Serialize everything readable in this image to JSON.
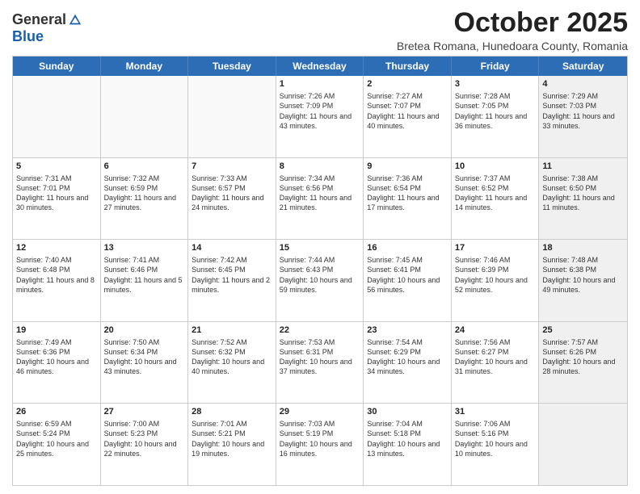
{
  "logo": {
    "general": "General",
    "blue": "Blue"
  },
  "title": "October 2025",
  "subtitle": "Bretea Romana, Hunedoara County, Romania",
  "headers": [
    "Sunday",
    "Monday",
    "Tuesday",
    "Wednesday",
    "Thursday",
    "Friday",
    "Saturday"
  ],
  "rows": [
    [
      {
        "day": "",
        "text": "",
        "empty": true
      },
      {
        "day": "",
        "text": "",
        "empty": true
      },
      {
        "day": "",
        "text": "",
        "empty": true
      },
      {
        "day": "1",
        "text": "Sunrise: 7:26 AM\nSunset: 7:09 PM\nDaylight: 11 hours and 43 minutes.",
        "empty": false
      },
      {
        "day": "2",
        "text": "Sunrise: 7:27 AM\nSunset: 7:07 PM\nDaylight: 11 hours and 40 minutes.",
        "empty": false
      },
      {
        "day": "3",
        "text": "Sunrise: 7:28 AM\nSunset: 7:05 PM\nDaylight: 11 hours and 36 minutes.",
        "empty": false
      },
      {
        "day": "4",
        "text": "Sunrise: 7:29 AM\nSunset: 7:03 PM\nDaylight: 11 hours and 33 minutes.",
        "empty": false,
        "shaded": true
      }
    ],
    [
      {
        "day": "5",
        "text": "Sunrise: 7:31 AM\nSunset: 7:01 PM\nDaylight: 11 hours and 30 minutes.",
        "empty": false
      },
      {
        "day": "6",
        "text": "Sunrise: 7:32 AM\nSunset: 6:59 PM\nDaylight: 11 hours and 27 minutes.",
        "empty": false
      },
      {
        "day": "7",
        "text": "Sunrise: 7:33 AM\nSunset: 6:57 PM\nDaylight: 11 hours and 24 minutes.",
        "empty": false
      },
      {
        "day": "8",
        "text": "Sunrise: 7:34 AM\nSunset: 6:56 PM\nDaylight: 11 hours and 21 minutes.",
        "empty": false
      },
      {
        "day": "9",
        "text": "Sunrise: 7:36 AM\nSunset: 6:54 PM\nDaylight: 11 hours and 17 minutes.",
        "empty": false
      },
      {
        "day": "10",
        "text": "Sunrise: 7:37 AM\nSunset: 6:52 PM\nDaylight: 11 hours and 14 minutes.",
        "empty": false
      },
      {
        "day": "11",
        "text": "Sunrise: 7:38 AM\nSunset: 6:50 PM\nDaylight: 11 hours and 11 minutes.",
        "empty": false,
        "shaded": true
      }
    ],
    [
      {
        "day": "12",
        "text": "Sunrise: 7:40 AM\nSunset: 6:48 PM\nDaylight: 11 hours and 8 minutes.",
        "empty": false
      },
      {
        "day": "13",
        "text": "Sunrise: 7:41 AM\nSunset: 6:46 PM\nDaylight: 11 hours and 5 minutes.",
        "empty": false
      },
      {
        "day": "14",
        "text": "Sunrise: 7:42 AM\nSunset: 6:45 PM\nDaylight: 11 hours and 2 minutes.",
        "empty": false
      },
      {
        "day": "15",
        "text": "Sunrise: 7:44 AM\nSunset: 6:43 PM\nDaylight: 10 hours and 59 minutes.",
        "empty": false
      },
      {
        "day": "16",
        "text": "Sunrise: 7:45 AM\nSunset: 6:41 PM\nDaylight: 10 hours and 56 minutes.",
        "empty": false
      },
      {
        "day": "17",
        "text": "Sunrise: 7:46 AM\nSunset: 6:39 PM\nDaylight: 10 hours and 52 minutes.",
        "empty": false
      },
      {
        "day": "18",
        "text": "Sunrise: 7:48 AM\nSunset: 6:38 PM\nDaylight: 10 hours and 49 minutes.",
        "empty": false,
        "shaded": true
      }
    ],
    [
      {
        "day": "19",
        "text": "Sunrise: 7:49 AM\nSunset: 6:36 PM\nDaylight: 10 hours and 46 minutes.",
        "empty": false
      },
      {
        "day": "20",
        "text": "Sunrise: 7:50 AM\nSunset: 6:34 PM\nDaylight: 10 hours and 43 minutes.",
        "empty": false
      },
      {
        "day": "21",
        "text": "Sunrise: 7:52 AM\nSunset: 6:32 PM\nDaylight: 10 hours and 40 minutes.",
        "empty": false
      },
      {
        "day": "22",
        "text": "Sunrise: 7:53 AM\nSunset: 6:31 PM\nDaylight: 10 hours and 37 minutes.",
        "empty": false
      },
      {
        "day": "23",
        "text": "Sunrise: 7:54 AM\nSunset: 6:29 PM\nDaylight: 10 hours and 34 minutes.",
        "empty": false
      },
      {
        "day": "24",
        "text": "Sunrise: 7:56 AM\nSunset: 6:27 PM\nDaylight: 10 hours and 31 minutes.",
        "empty": false
      },
      {
        "day": "25",
        "text": "Sunrise: 7:57 AM\nSunset: 6:26 PM\nDaylight: 10 hours and 28 minutes.",
        "empty": false,
        "shaded": true
      }
    ],
    [
      {
        "day": "26",
        "text": "Sunrise: 6:59 AM\nSunset: 5:24 PM\nDaylight: 10 hours and 25 minutes.",
        "empty": false
      },
      {
        "day": "27",
        "text": "Sunrise: 7:00 AM\nSunset: 5:23 PM\nDaylight: 10 hours and 22 minutes.",
        "empty": false
      },
      {
        "day": "28",
        "text": "Sunrise: 7:01 AM\nSunset: 5:21 PM\nDaylight: 10 hours and 19 minutes.",
        "empty": false
      },
      {
        "day": "29",
        "text": "Sunrise: 7:03 AM\nSunset: 5:19 PM\nDaylight: 10 hours and 16 minutes.",
        "empty": false
      },
      {
        "day": "30",
        "text": "Sunrise: 7:04 AM\nSunset: 5:18 PM\nDaylight: 10 hours and 13 minutes.",
        "empty": false
      },
      {
        "day": "31",
        "text": "Sunrise: 7:06 AM\nSunset: 5:16 PM\nDaylight: 10 hours and 10 minutes.",
        "empty": false
      },
      {
        "day": "",
        "text": "",
        "empty": true,
        "shaded": true
      }
    ]
  ]
}
